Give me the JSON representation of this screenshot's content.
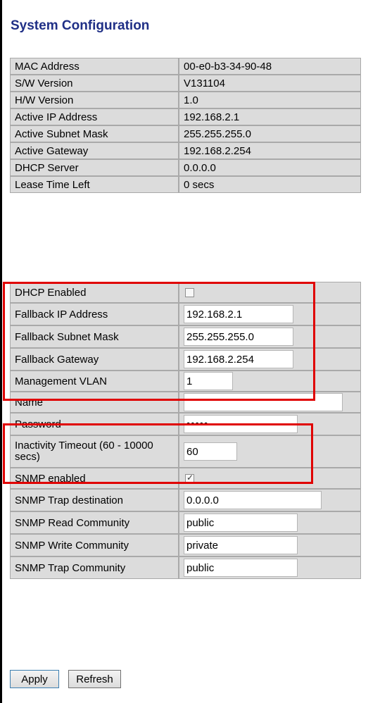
{
  "page": {
    "title": "System Configuration"
  },
  "info": {
    "rows": [
      {
        "label": "MAC Address",
        "value": "00-e0-b3-34-90-48"
      },
      {
        "label": "S/W Version",
        "value": "V131104"
      },
      {
        "label": "H/W Version",
        "value": "1.0"
      },
      {
        "label": "Active IP Address",
        "value": "192.168.2.1"
      },
      {
        "label": "Active Subnet Mask",
        "value": "255.255.255.0"
      },
      {
        "label": "Active Gateway",
        "value": "192.168.2.254"
      },
      {
        "label": "DHCP Server",
        "value": "0.0.0.0"
      },
      {
        "label": "Lease Time Left",
        "value": "0 secs"
      }
    ]
  },
  "config": {
    "dhcp_enabled": {
      "label": "DHCP Enabled",
      "checked": false
    },
    "fallback_ip": {
      "label": "Fallback IP Address",
      "value": "192.168.2.1"
    },
    "fallback_mask": {
      "label": "Fallback Subnet Mask",
      "value": "255.255.255.0"
    },
    "fallback_gateway": {
      "label": "Fallback Gateway",
      "value": "192.168.2.254"
    },
    "mgmt_vlan": {
      "label": "Management VLAN",
      "value": "1"
    },
    "name": {
      "label": "Name",
      "value": ""
    },
    "password": {
      "label": "Password",
      "value": "•••••"
    },
    "inactivity": {
      "label": "Inactivity Timeout (60 - 10000 secs)",
      "value": "60"
    },
    "snmp_enabled": {
      "label": "SNMP enabled",
      "checked": true
    },
    "snmp_trap_dest": {
      "label": "SNMP Trap destination",
      "value": "0.0.0.0"
    },
    "snmp_read": {
      "label": "SNMP Read Community",
      "value": "public"
    },
    "snmp_write": {
      "label": "SNMP Write Community",
      "value": "private"
    },
    "snmp_trap_comm": {
      "label": "SNMP Trap Community",
      "value": "public"
    }
  },
  "buttons": {
    "apply": "Apply",
    "refresh": "Refresh"
  },
  "colors": {
    "title": "#1f2f86",
    "highlight": "#e00000",
    "cell_bg": "#dcdcdc"
  },
  "icons": {
    "checkbox_checked": "check-icon"
  }
}
